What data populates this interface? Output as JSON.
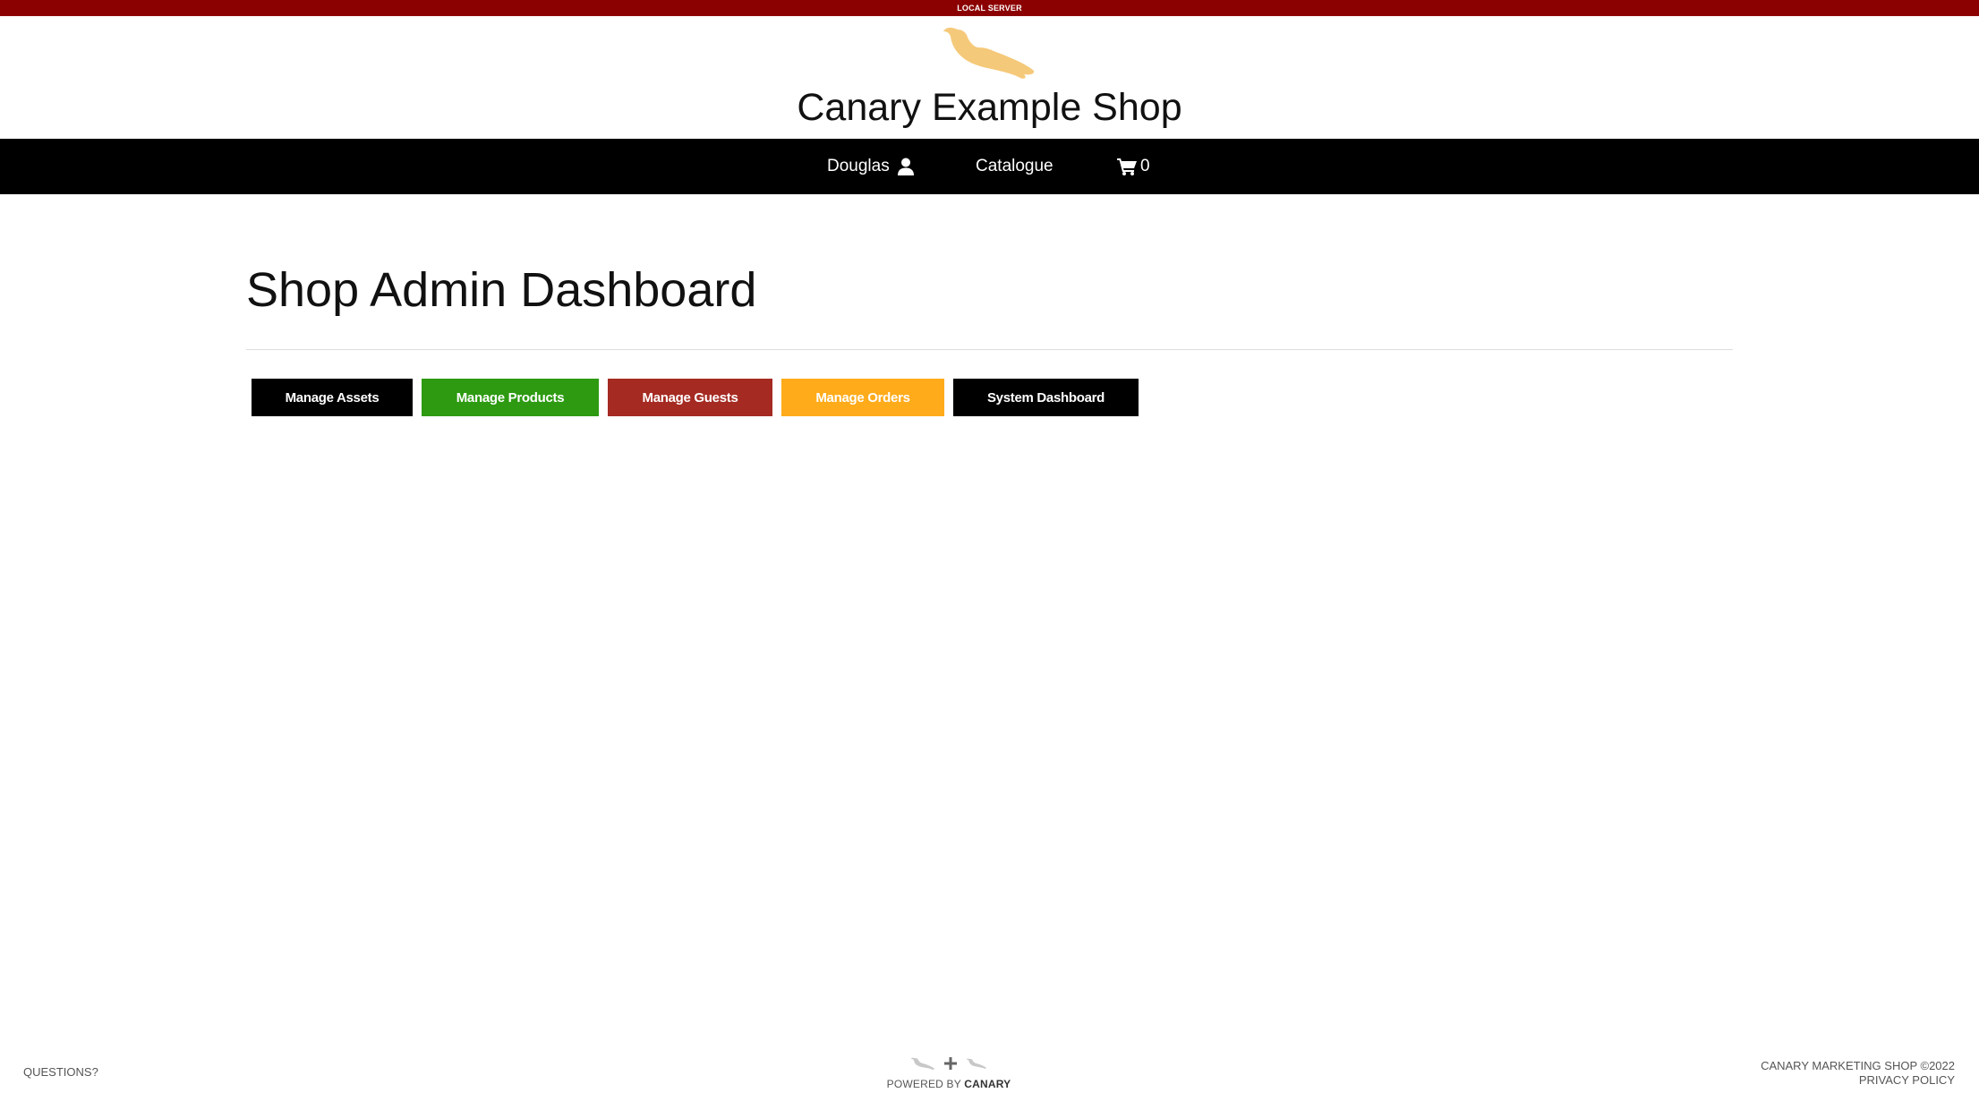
{
  "environment": {
    "label": "LOCAL SERVER",
    "color": "#8b0000"
  },
  "header": {
    "site_title": "Canary Example Shop",
    "logo_icon": "canary-bird-logo",
    "logo_color": "#f5c97a"
  },
  "nav": {
    "user_name": "Douglas",
    "user_icon": "user-icon",
    "catalogue_label": "Catalogue",
    "cart_icon": "shopping-cart-icon",
    "cart_count": "0"
  },
  "main": {
    "page_title": "Shop Admin Dashboard",
    "buttons": [
      {
        "label": "Manage Assets",
        "color": "#000000"
      },
      {
        "label": "Manage Products",
        "color": "#2d9a11"
      },
      {
        "label": "Manage Guests",
        "color": "#a52a22"
      },
      {
        "label": "Manage Orders",
        "color": "#ffab1a"
      },
      {
        "label": "System Dashboard",
        "color": "#000000"
      }
    ]
  },
  "footer": {
    "questions_label": "QUESTIONS?",
    "powered_by_prefix": "POWERED BY",
    "powered_by_brand": "CANARY",
    "copyright": "CANARY MARKETING SHOP ©2022",
    "privacy_label": "PRIVACY POLICY"
  }
}
